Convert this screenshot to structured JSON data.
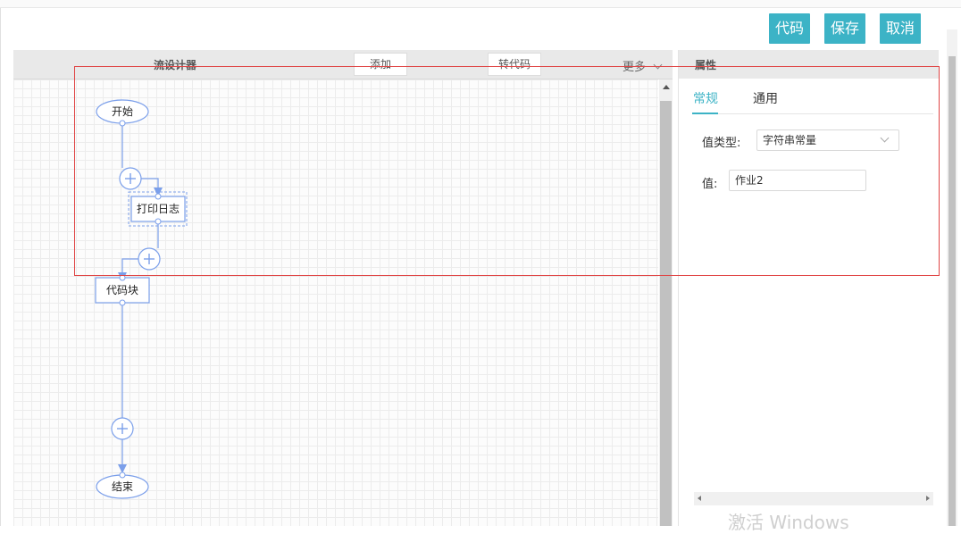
{
  "header": {
    "code_button": "代码",
    "save_button": "保存",
    "cancel_button": "取消"
  },
  "designer": {
    "title": "流设计器",
    "add_button": "添加",
    "to_code_button": "转代码",
    "more_menu": "更多"
  },
  "flow": {
    "start_node": "开始",
    "log_node": "打印日志",
    "code_node": "代码块",
    "end_node": "结束"
  },
  "properties": {
    "title": "属性",
    "tabs": [
      {
        "label": "常规",
        "active": true
      },
      {
        "label": "通用",
        "active": false
      }
    ],
    "value_type_label": "值类型:",
    "value_type_selected": "字符串常量",
    "value_label": "值:",
    "value_input": "作业2"
  },
  "system": {
    "watermark": "激活 Windows"
  },
  "colors": {
    "accent": "#3cb3c6",
    "node_stroke": "#7b9fea",
    "highlight_box": "#e04545"
  }
}
